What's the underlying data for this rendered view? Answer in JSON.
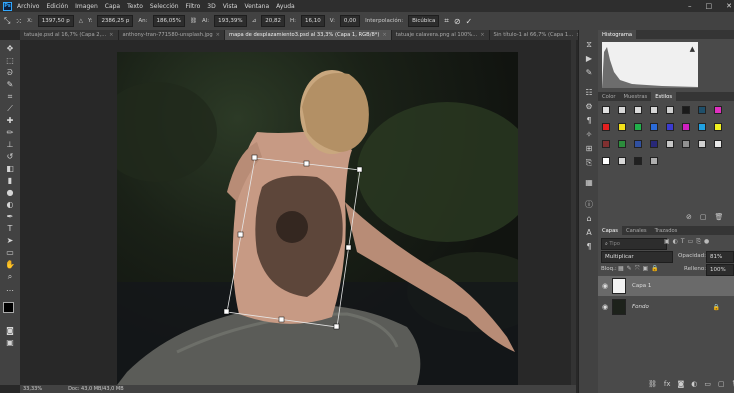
{
  "app": {
    "logo": "Ps"
  },
  "menu": [
    "Archivo",
    "Edición",
    "Imagen",
    "Capa",
    "Texto",
    "Selección",
    "Filtro",
    "3D",
    "Vista",
    "Ventana",
    "Ayuda"
  ],
  "window_controls": [
    "–",
    "□",
    "✕"
  ],
  "options": {
    "x_value": "1397,50 p",
    "y_value": "2386,25 p",
    "w_value": "186,05%",
    "h_value": "193,39%",
    "angle_value": "20,82",
    "h_skew": "16,10",
    "v_skew": "0,00",
    "interp_label": "Interpolación:",
    "interp_value": "Bicúbica",
    "w_label": "An:",
    "h_label": "Al:",
    "angle_label": "⊿",
    "hskew_label": "H:",
    "vskew_label": "V:",
    "x_label": "X:",
    "y_label": "Y:"
  },
  "tabs": [
    {
      "label": "tatuaje.psd al 16,7% (Capa 2,...",
      "active": false
    },
    {
      "label": "anthony-tran-771580-unsplash.jpg",
      "active": false
    },
    {
      "label": "mapa de desplazamiento3.psd al 33,3% (Capa 1, RGB/8*)",
      "active": true
    },
    {
      "label": "tatuaje calavera.png al 100%...",
      "active": false
    },
    {
      "label": "Sin título-1 al 66,7% (Capa 1...",
      "active": false
    }
  ],
  "status": {
    "zoom": "33,33%",
    "doc": "Doc: 43,0 MB/43,0 MB"
  },
  "histogram": {
    "title": "Histograma"
  },
  "styles_panel": {
    "tabs": [
      "Color",
      "Muestras",
      "Estilos"
    ],
    "active": "Estilos"
  },
  "layers_panel": {
    "tabs": [
      "Capas",
      "Canales",
      "Trazados"
    ],
    "search_placeholder": "Tipo",
    "blend_mode": "Multiplicar",
    "opacity_label": "Opacidad:",
    "opacity_value": "81%",
    "lock_label": "Bloq.:",
    "fill_label": "Relleno:",
    "fill_value": "100%",
    "layers": [
      {
        "name": "Capa 1",
        "selected": true
      },
      {
        "name": "Fondo",
        "selected": false
      }
    ]
  },
  "colors": {
    "accent": "#31a8ff",
    "panel": "#4a4a4a",
    "canvas": "#282828"
  }
}
